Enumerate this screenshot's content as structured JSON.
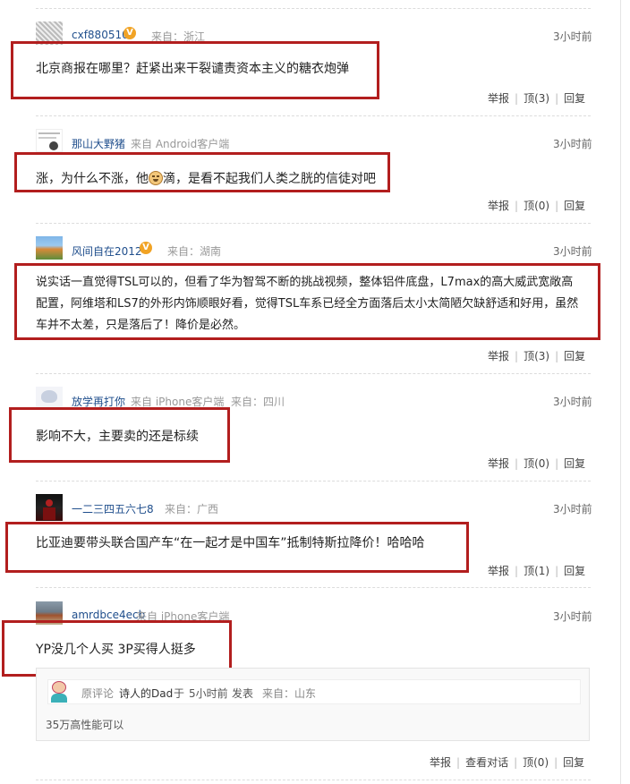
{
  "comments": [
    {
      "username": "cxf880510",
      "verified": true,
      "source": "来自：浙江",
      "time": "3小时前",
      "content": "北京商报在哪里？赶紧出来干裂谴责资本主义的糖衣炮弹",
      "actions": {
        "report": "举报",
        "up": "顶(3)",
        "reply": "回复"
      }
    },
    {
      "username": "那山大野猪",
      "verified": false,
      "source": "来自 Android客户端",
      "time": "3小时前",
      "content_before": "涨，为什么不涨，他",
      "content_after": "滴，是看不起我们人类之胱的信徒对吧",
      "actions": {
        "report": "举报",
        "up": "顶(0)",
        "reply": "回复"
      }
    },
    {
      "username": "风间自在2012",
      "verified": true,
      "source": "来自：湖南",
      "time": "3小时前",
      "content": "说实话一直觉得TSL可以的，但看了华为智驾不断的挑战视频，整体铝件底盘，L7max的高大威武宽敞高配置，阿维塔和LS7的外形内饰顺眼好看，觉得TSL车系已经全方面落后太小太简陋欠缺舒适和好用，虽然车并不太差，只是落后了！降价是必然。",
      "actions": {
        "report": "举报",
        "up": "顶(3)",
        "reply": "回复"
      }
    },
    {
      "username": "放学再打你",
      "verified": false,
      "source": "来自 iPhone客户端",
      "location": "来自：四川",
      "time": "3小时前",
      "content": "影响不大，主要卖的还是标续",
      "actions": {
        "report": "举报",
        "up": "顶(0)",
        "reply": "回复"
      }
    },
    {
      "username": "一二三四五六七8",
      "verified": false,
      "source": "来自：广西",
      "time": "3小时前",
      "content": "比亚迪要带头联合国产车“在一起才是中国车”抵制特斯拉降价！哈哈哈",
      "actions": {
        "report": "举报",
        "up": "顶(1)",
        "reply": "回复"
      }
    },
    {
      "username": "amrdbce4ecb",
      "verified": false,
      "source": "来自 iPhone客户端",
      "time": "3小时前",
      "content": "YP没几个人买 3P买得人挺多",
      "quote": {
        "label": "原评论",
        "user": "诗人的Dad",
        "prep": "于",
        "time": "5小时前",
        "action": "发表",
        "location": "来自：山东",
        "text": "35万高性能可以"
      },
      "actions": {
        "report": "举报",
        "conversation": "查看对话",
        "up": "顶(0)",
        "reply": "回复"
      }
    }
  ],
  "colors": {
    "highlight": "#b21e1e",
    "username": "#1f4e8c",
    "badge": "#f1a325"
  },
  "icons": {
    "verified": "verified-badge-icon",
    "emoji": "grinning-face-emoji-icon"
  }
}
